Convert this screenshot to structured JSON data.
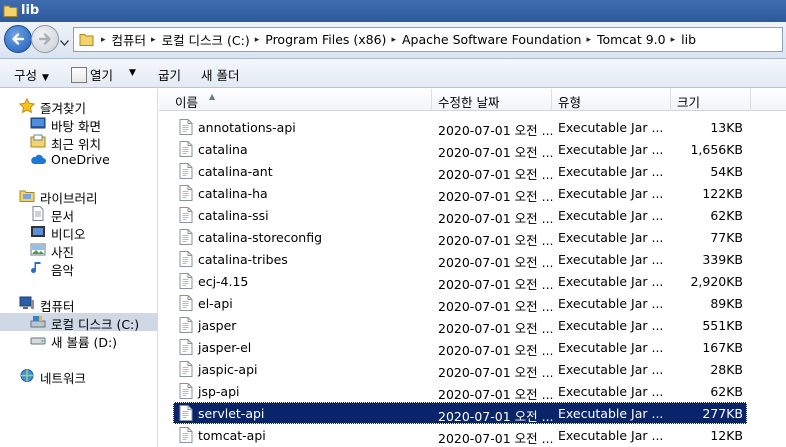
{
  "window": {
    "title": "lib"
  },
  "address": {
    "crumbs": [
      "컴퓨터",
      "로컬 디스크 (C:)",
      "Program Files (x86)",
      "Apache Software Foundation",
      "Tomcat 9.0",
      "lib"
    ]
  },
  "toolbar": {
    "organize": "구성",
    "open": "열기",
    "burn": "굽기",
    "new_folder": "새 폴더"
  },
  "nav": {
    "favorites": "즐겨찾기",
    "desktop": "바탕 화면",
    "recent": "최근 위치",
    "onedrive": "OneDrive",
    "libraries": "라이브러리",
    "documents": "문서",
    "videos": "비디오",
    "pictures": "사진",
    "music": "음악",
    "computer": "컴퓨터",
    "local_disk": "로컬 디스크 (C:)",
    "new_volume": "새 볼륨 (D:)",
    "network": "네트워크"
  },
  "columns": {
    "name": "이름",
    "date": "수정한 날짜",
    "type": "유형",
    "size": "크기"
  },
  "files": [
    {
      "name": "annotations-api",
      "date": "2020-07-01 오전 ...",
      "type": "Executable Jar ...",
      "size": "13KB"
    },
    {
      "name": "catalina",
      "date": "2020-07-01 오전 ...",
      "type": "Executable Jar ...",
      "size": "1,656KB"
    },
    {
      "name": "catalina-ant",
      "date": "2020-07-01 오전 ...",
      "type": "Executable Jar ...",
      "size": "54KB"
    },
    {
      "name": "catalina-ha",
      "date": "2020-07-01 오전 ...",
      "type": "Executable Jar ...",
      "size": "122KB"
    },
    {
      "name": "catalina-ssi",
      "date": "2020-07-01 오전 ...",
      "type": "Executable Jar ...",
      "size": "62KB"
    },
    {
      "name": "catalina-storeconfig",
      "date": "2020-07-01 오전 ...",
      "type": "Executable Jar ...",
      "size": "77KB"
    },
    {
      "name": "catalina-tribes",
      "date": "2020-07-01 오전 ...",
      "type": "Executable Jar ...",
      "size": "339KB"
    },
    {
      "name": "ecj-4.15",
      "date": "2020-07-01 오전 ...",
      "type": "Executable Jar ...",
      "size": "2,920KB"
    },
    {
      "name": "el-api",
      "date": "2020-07-01 오전 ...",
      "type": "Executable Jar ...",
      "size": "89KB"
    },
    {
      "name": "jasper",
      "date": "2020-07-01 오전 ...",
      "type": "Executable Jar ...",
      "size": "551KB"
    },
    {
      "name": "jasper-el",
      "date": "2020-07-01 오전 ...",
      "type": "Executable Jar ...",
      "size": "167KB"
    },
    {
      "name": "jaspic-api",
      "date": "2020-07-01 오전 ...",
      "type": "Executable Jar ...",
      "size": "28KB"
    },
    {
      "name": "jsp-api",
      "date": "2020-07-01 오전 ...",
      "type": "Executable Jar ...",
      "size": "62KB"
    },
    {
      "name": "servlet-api",
      "date": "2020-07-01 오전 ...",
      "type": "Executable Jar ...",
      "size": "277KB",
      "selected": true
    },
    {
      "name": "tomcat-api",
      "date": "2020-07-01 오전 ...",
      "type": "Executable Jar ...",
      "size": "12KB"
    }
  ],
  "colors": {
    "selection": "#0a246a",
    "title_bar": "#2c5a9c"
  }
}
